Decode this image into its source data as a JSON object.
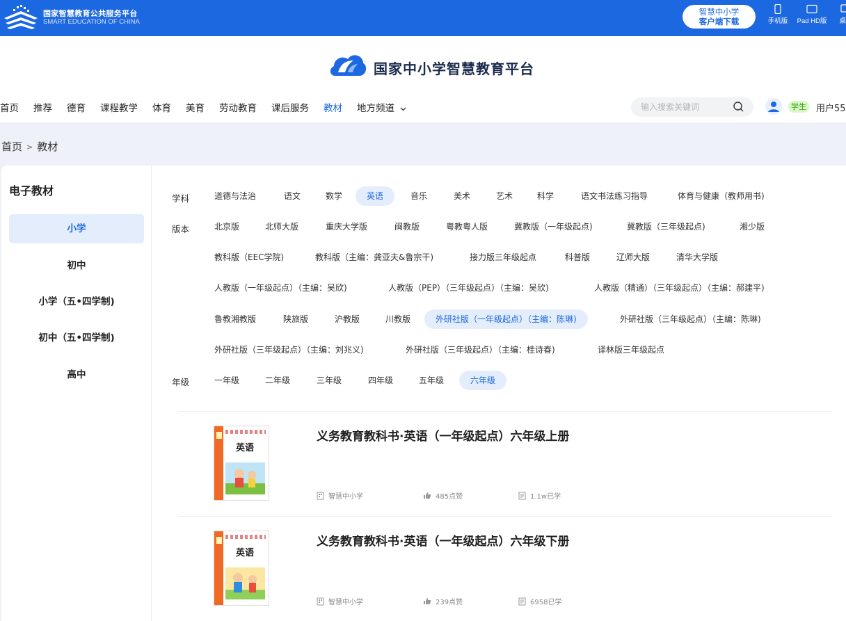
{
  "header": {
    "logo_cn": "国家智慧教育公共服务平台",
    "logo_en": "SMART EDUCATION OF CHINA",
    "download_line1": "智慧中小学",
    "download_line2": "客户端下载",
    "devices": [
      "手机版",
      "Pad HD版",
      "桌面"
    ]
  },
  "brand": {
    "title": "国家中小学智慧教育平台"
  },
  "nav": {
    "items": [
      "首页",
      "推荐",
      "德育",
      "课程教学",
      "体育",
      "美育",
      "劳动教育",
      "课后服务",
      "教材",
      "地方频道"
    ],
    "active": "教材",
    "dropdown_icon": "chevron-down-icon"
  },
  "search": {
    "placeholder": "输入搜索关键词"
  },
  "user": {
    "role": "学生",
    "name": "用户55"
  },
  "breadcrumb": {
    "home": "首页",
    "sep": ">",
    "current": "教材"
  },
  "sidebar": {
    "title": "电子教材",
    "items": [
      "小学",
      "初中",
      "小学（五•四学制)",
      "初中（五•四学制)",
      "高中"
    ],
    "active": "小学"
  },
  "filters": {
    "subject_label": "学科",
    "subjects": [
      "道德与法治",
      "语文",
      "数学",
      "英语",
      "音乐",
      "美术",
      "艺术",
      "科学",
      "语文书法练习指导",
      "体育与健康（教师用书)"
    ],
    "subject_active": "英语",
    "edition_label": "版本",
    "editions": [
      "北京版",
      "北师大版",
      "重庆大学版",
      "闽教版",
      "粤教粤人版",
      "冀教版（一年级起点)",
      "冀教版（三年级起点)",
      "湘少版",
      "教科版（EEC学院)",
      "教科版（主编：龚亚夫&鲁宗干)",
      "接力版三年级起点",
      "科普版",
      "辽师大版",
      "清华大学版",
      "人教版（一年级起点）（主编：吴欣)",
      "人教版（PEP）（三年级起点）（主编：吴欣)",
      "人教版（精通）（三年级起点）（主编：郝建平)",
      "鲁教湘教版",
      "陕旅版",
      "沪教版",
      "川教版",
      "外研社版（一年级起点）（主编：陈琳)",
      "外研社版（三年级起点）（主编：陈琳)",
      "外研社版（三年级起点）（主编：刘兆义)",
      "外研社版（三年级起点）（主编：桂诗春)",
      "译林版三年级起点"
    ],
    "edition_active": "外研社版（一年级起点）（主编：陈琳)",
    "grade_label": "年级",
    "grades": [
      "一年级",
      "二年级",
      "三年级",
      "四年级",
      "五年级",
      "六年级"
    ],
    "grade_active": "六年级"
  },
  "books": [
    {
      "title": "义务教育教科书·英语（一年级起点）六年级上册",
      "cover_text": "英语",
      "publisher": "智慧中小学",
      "likes": "485点赞",
      "learners": "1.1w已学"
    },
    {
      "title": "义务教育教科书·英语（一年级起点）六年级下册",
      "cover_text": "英语",
      "publisher": "智慧中小学",
      "likes": "239点赞",
      "learners": "6958已学"
    }
  ],
  "colors": {
    "primary": "#1c68e0",
    "active_bg": "#e4edfc",
    "band": "#eef1f7",
    "role_bg": "#d9f7c8",
    "cover_strip": "#f06a26"
  }
}
